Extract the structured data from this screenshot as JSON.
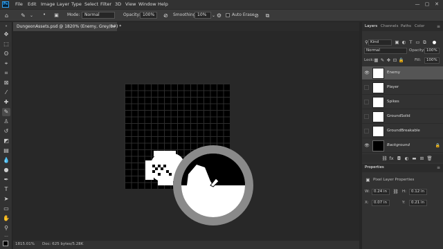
{
  "menubar": {
    "logo": "Ps",
    "items": [
      "File",
      "Edit",
      "Image",
      "Layer",
      "Type",
      "Select",
      "Filter",
      "3D",
      "View",
      "Window",
      "Help"
    ],
    "window_controls": [
      "—",
      "▢",
      "✕"
    ]
  },
  "options": {
    "mode_label": "Mode:",
    "mode_value": "Normal",
    "opacity_label": "Opacity:",
    "opacity_value": "100%",
    "smoothing_label": "Smoothing:",
    "smoothing_value": "10%",
    "auto_erase_label": "Auto Erase"
  },
  "document": {
    "tab_title": "DungeonAssets.psd @ 1820% (Enemy, Grey/8#) *",
    "close": "×"
  },
  "status": {
    "zoom": "1815.01%",
    "doc_info": "Doc: 625 bytes/5.23K"
  },
  "layers_panel": {
    "tabs": [
      "Layers",
      "Channels",
      "Paths",
      "Color"
    ],
    "filter_label": "Kind",
    "blend_mode": "Normal",
    "opacity_label": "Opacity:",
    "opacity_value": "100%",
    "lock_label": "Lock:",
    "fill_label": "Fill:",
    "fill_value": "100%",
    "layers": [
      {
        "name": "Enemy",
        "visible": true,
        "selected": true
      },
      {
        "name": "Player",
        "visible": false,
        "selected": false
      },
      {
        "name": "Spikes",
        "visible": false,
        "selected": false
      },
      {
        "name": "GroundSolid",
        "visible": false,
        "selected": false
      },
      {
        "name": "GroundBreakable",
        "visible": false,
        "selected": false
      },
      {
        "name": "Background",
        "visible": true,
        "selected": false
      }
    ]
  },
  "properties_panel": {
    "title": "Properties",
    "subtitle": "Pixel Layer Properties",
    "w_label": "W:",
    "w_value": "0.24 in",
    "h_label": "H:",
    "h_value": "0.12 in",
    "x_label": "X:",
    "x_value": "0.07 in",
    "y_label": "Y:",
    "y_value": "0.21 in"
  },
  "colors": {
    "accent": "#31a8ff",
    "ui_dark": "#282828",
    "panel": "#323232",
    "selected_layer": "#555555"
  }
}
